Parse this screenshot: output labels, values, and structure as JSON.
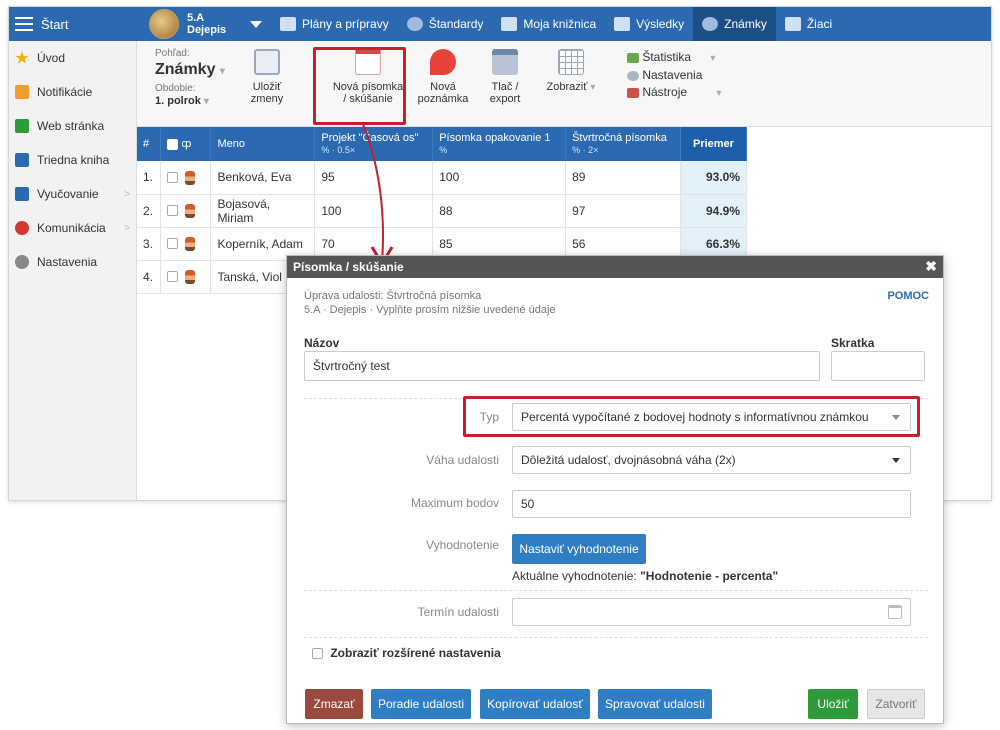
{
  "topbar": {
    "start": "Štart",
    "class_code": "5.A",
    "class_subject": "Dejepis",
    "nav": [
      "Plány a prípravy",
      "Štandardy",
      "Moja knižnica",
      "Výsledky",
      "Známky",
      "Žiaci"
    ]
  },
  "sidebar": {
    "items": [
      {
        "label": "Úvod",
        "color": "#f0b400"
      },
      {
        "label": "Notifikácie",
        "color": "#f29b33"
      },
      {
        "label": "Web stránka",
        "color": "#2e9a3a"
      },
      {
        "label": "Triedna kniha",
        "color": "#2b6ab0"
      },
      {
        "label": "Vyučovanie",
        "color": "#2b6ab0"
      },
      {
        "label": "Komunikácia",
        "color": "#d23a2e"
      },
      {
        "label": "Nastavenia",
        "color": "#888888"
      }
    ]
  },
  "toolbar": {
    "view_label": "Pohľad:",
    "view_value": "Známky",
    "period_label": "Obdobie:",
    "period_value": "1. polrok",
    "save": [
      "Uložiť",
      "zmeny"
    ],
    "new_test": [
      "Nová písomka",
      "/ skúšanie"
    ],
    "new_note": [
      "Nová",
      "poznámka"
    ],
    "print": [
      "Tlač /",
      "export"
    ],
    "show": "Zobraziť",
    "stats": "Štatistika",
    "settings": "Nastavenia",
    "tools": "Nástroje"
  },
  "grid": {
    "headers": {
      "num": "#",
      "phi": "ȹ",
      "name": "Meno",
      "c1": "Projekt \"Časová os\"",
      "c1u": "% · 0.5×",
      "c2": "Písomka opakovanie 1",
      "c2u": "%",
      "c3": "Štvrtročná písomka",
      "c3u": "% · 2×",
      "avg": "Priemer"
    },
    "rows": [
      {
        "num": "1.",
        "name": "Benková, Eva",
        "c1": "95",
        "c2": "100",
        "c3": "89",
        "avg": "93.0%"
      },
      {
        "num": "2.",
        "name": "Bojasová, Miriam",
        "c1": "100",
        "c2": "88",
        "c3": "97",
        "avg": "94.9%"
      },
      {
        "num": "3.",
        "name": "Koperník, Adam",
        "c1": "70",
        "c2": "85",
        "c3": "56",
        "avg": "66.3%"
      },
      {
        "num": "4.",
        "name": "Tanská, Viol",
        "c1": "",
        "c2": "",
        "c3": "",
        "avg": ""
      }
    ]
  },
  "modal": {
    "title": "Písomka / skúšanie",
    "sub1": "Úprava udalosti: Štvrtročná písomka",
    "sub2": "5.A · Dejepis · Vyplňte prosím nižšie uvedené údaje",
    "help": "POMOC",
    "name_label": "Názov",
    "name_value": "Štvrtročný test",
    "abbr_label": "Skratka",
    "abbr_value": "",
    "type_label": "Typ",
    "type_value": "Percentá vypočítané z bodovej hodnoty s informatívnou známkou",
    "weight_label": "Váha udalosti",
    "weight_value": "Dôležitá udalosť, dvojnásobná váha (2x)",
    "max_label": "Maximum bodov",
    "max_value": "50",
    "eval_label": "Vyhodnotenie",
    "eval_button": "Nastaviť vyhodnotenie",
    "eval_current_label": "Aktuálne vyhodnotenie:",
    "eval_current_value": "\"Hodnotenie - percenta\"",
    "date_label": "Termín udalosti",
    "date_value": "",
    "advanced": "Zobraziť rozšírené nastavenia",
    "buttons": {
      "delete": "Zmazať",
      "order": "Poradie udalosti",
      "copy": "Kopírovať udalosť",
      "manage": "Spravovať udalosti",
      "save": "Uložiť",
      "close": "Zatvoriť"
    }
  },
  "colors": {
    "primary": "#2b6ab0",
    "highlight": "#c6202d",
    "delete": "#9a4a3c",
    "save": "#2e9a3a"
  }
}
